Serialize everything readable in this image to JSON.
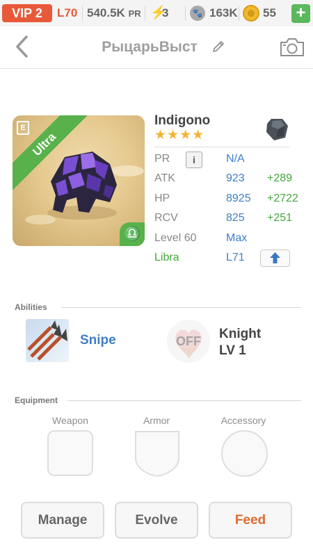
{
  "status_bar": {
    "vip": "VIP 2",
    "level": "L70",
    "pr_value": "540.5K",
    "pr_unit": "PR",
    "energy": "3",
    "paws": "163K",
    "coins": "55",
    "add_label": "+",
    "colors": {
      "vip": "#e8593a",
      "add": "#5cb85c",
      "coin": "#f0b82c"
    }
  },
  "header": {
    "title": "РыцарьВыст"
  },
  "pet": {
    "name": "Indigono",
    "stars": "★★★★",
    "rarity_label": "Ultra",
    "element_symbol": "♎",
    "badge_letter": "E",
    "stats": {
      "pr_label": "PR",
      "pr_info": "i",
      "pr_value": "N/A",
      "atk_label": "ATK",
      "atk_value": "923",
      "atk_bonus": "+289",
      "hp_label": "HP",
      "hp_value": "8925",
      "hp_bonus": "+2722",
      "rcv_label": "RCV",
      "rcv_value": "825",
      "rcv_bonus": "+251",
      "level_label": "Level 60",
      "level_value": "Max",
      "zodiac_label": "Libra",
      "zodiac_level": "L71"
    }
  },
  "abilities": {
    "heading": "Abilities",
    "items": [
      {
        "name": "Snipe",
        "icon": "arrows-icon"
      },
      {
        "name": "Knight",
        "level": "LV 1",
        "state": "OFF",
        "icon": "heart-shield-icon"
      }
    ]
  },
  "equipment": {
    "heading": "Equipment",
    "slots": [
      "Weapon",
      "Armor",
      "Accessory"
    ]
  },
  "actions": {
    "manage": "Manage",
    "evolve": "Evolve",
    "feed": "Feed"
  }
}
